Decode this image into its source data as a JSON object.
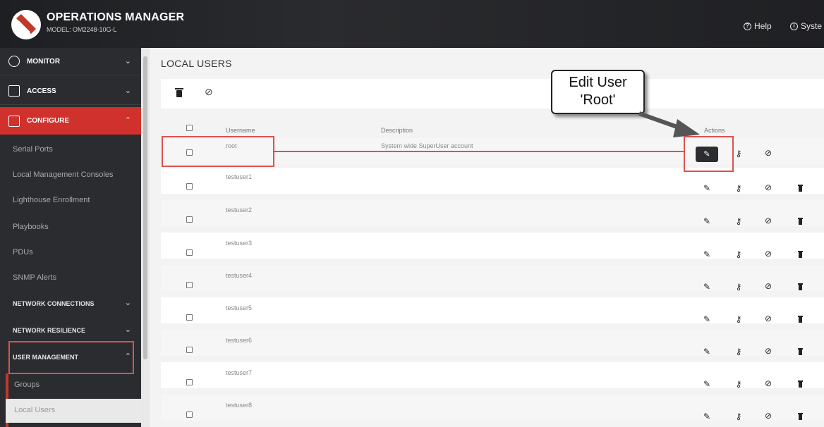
{
  "header": {
    "title": "OPERATIONS MANAGER",
    "model": "MODEL: OM2248-10G-L",
    "help_label": "Help",
    "system_label": "Syste"
  },
  "sidebar": {
    "sections": [
      {
        "label": "MONITOR",
        "icon": "gauge-icon",
        "expanded": false
      },
      {
        "label": "ACCESS",
        "icon": "door-icon",
        "expanded": false
      },
      {
        "label": "CONFIGURE",
        "icon": "monitor-icon",
        "expanded": true
      }
    ],
    "configure_items": [
      "Serial Ports",
      "Local Management Consoles",
      "Lighthouse Enrollment",
      "Playbooks",
      "PDUs",
      "SNMP Alerts"
    ],
    "groups": [
      {
        "label": "NETWORK CONNECTIONS"
      },
      {
        "label": "NETWORK RESILIENCE"
      },
      {
        "label": "USER MANAGEMENT"
      }
    ],
    "user_management_items": [
      "Groups",
      "Local Users"
    ]
  },
  "main": {
    "title": "LOCAL USERS",
    "columns": {
      "username": "Username",
      "description": "Description",
      "actions": "Actions"
    },
    "rows": [
      {
        "username": "root",
        "description": "System wide SuperUser account"
      },
      {
        "username": "testuser1",
        "description": ""
      },
      {
        "username": "testuser2",
        "description": ""
      },
      {
        "username": "testuser3",
        "description": ""
      },
      {
        "username": "testuser4",
        "description": ""
      },
      {
        "username": "testuser5",
        "description": ""
      },
      {
        "username": "testuser6",
        "description": ""
      },
      {
        "username": "testuser7",
        "description": ""
      },
      {
        "username": "testuser8",
        "description": ""
      }
    ]
  },
  "annotation": {
    "line1": "Edit User",
    "line2": "'Root'"
  },
  "colors": {
    "accent_red": "#d0312d",
    "highlight_red": "#d9534f",
    "sidebar_bg": "#2b2c2f"
  }
}
